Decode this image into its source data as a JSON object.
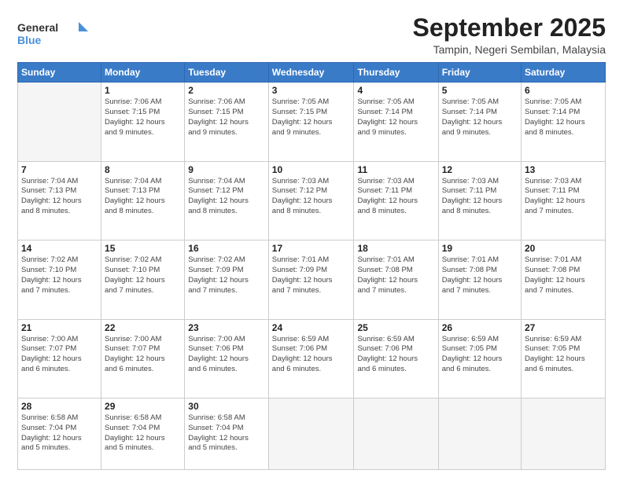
{
  "logo": {
    "line1": "General",
    "line2": "Blue"
  },
  "title": "September 2025",
  "location": "Tampin, Negeri Sembilan, Malaysia",
  "header_days": [
    "Sunday",
    "Monday",
    "Tuesday",
    "Wednesday",
    "Thursday",
    "Friday",
    "Saturday"
  ],
  "weeks": [
    [
      {
        "day": "",
        "info": ""
      },
      {
        "day": "1",
        "info": "Sunrise: 7:06 AM\nSunset: 7:15 PM\nDaylight: 12 hours\nand 9 minutes."
      },
      {
        "day": "2",
        "info": "Sunrise: 7:06 AM\nSunset: 7:15 PM\nDaylight: 12 hours\nand 9 minutes."
      },
      {
        "day": "3",
        "info": "Sunrise: 7:05 AM\nSunset: 7:15 PM\nDaylight: 12 hours\nand 9 minutes."
      },
      {
        "day": "4",
        "info": "Sunrise: 7:05 AM\nSunset: 7:14 PM\nDaylight: 12 hours\nand 9 minutes."
      },
      {
        "day": "5",
        "info": "Sunrise: 7:05 AM\nSunset: 7:14 PM\nDaylight: 12 hours\nand 9 minutes."
      },
      {
        "day": "6",
        "info": "Sunrise: 7:05 AM\nSunset: 7:14 PM\nDaylight: 12 hours\nand 8 minutes."
      }
    ],
    [
      {
        "day": "7",
        "info": "Sunrise: 7:04 AM\nSunset: 7:13 PM\nDaylight: 12 hours\nand 8 minutes."
      },
      {
        "day": "8",
        "info": "Sunrise: 7:04 AM\nSunset: 7:13 PM\nDaylight: 12 hours\nand 8 minutes."
      },
      {
        "day": "9",
        "info": "Sunrise: 7:04 AM\nSunset: 7:12 PM\nDaylight: 12 hours\nand 8 minutes."
      },
      {
        "day": "10",
        "info": "Sunrise: 7:03 AM\nSunset: 7:12 PM\nDaylight: 12 hours\nand 8 minutes."
      },
      {
        "day": "11",
        "info": "Sunrise: 7:03 AM\nSunset: 7:11 PM\nDaylight: 12 hours\nand 8 minutes."
      },
      {
        "day": "12",
        "info": "Sunrise: 7:03 AM\nSunset: 7:11 PM\nDaylight: 12 hours\nand 8 minutes."
      },
      {
        "day": "13",
        "info": "Sunrise: 7:03 AM\nSunset: 7:11 PM\nDaylight: 12 hours\nand 7 minutes."
      }
    ],
    [
      {
        "day": "14",
        "info": "Sunrise: 7:02 AM\nSunset: 7:10 PM\nDaylight: 12 hours\nand 7 minutes."
      },
      {
        "day": "15",
        "info": "Sunrise: 7:02 AM\nSunset: 7:10 PM\nDaylight: 12 hours\nand 7 minutes."
      },
      {
        "day": "16",
        "info": "Sunrise: 7:02 AM\nSunset: 7:09 PM\nDaylight: 12 hours\nand 7 minutes."
      },
      {
        "day": "17",
        "info": "Sunrise: 7:01 AM\nSunset: 7:09 PM\nDaylight: 12 hours\nand 7 minutes."
      },
      {
        "day": "18",
        "info": "Sunrise: 7:01 AM\nSunset: 7:08 PM\nDaylight: 12 hours\nand 7 minutes."
      },
      {
        "day": "19",
        "info": "Sunrise: 7:01 AM\nSunset: 7:08 PM\nDaylight: 12 hours\nand 7 minutes."
      },
      {
        "day": "20",
        "info": "Sunrise: 7:01 AM\nSunset: 7:08 PM\nDaylight: 12 hours\nand 7 minutes."
      }
    ],
    [
      {
        "day": "21",
        "info": "Sunrise: 7:00 AM\nSunset: 7:07 PM\nDaylight: 12 hours\nand 6 minutes."
      },
      {
        "day": "22",
        "info": "Sunrise: 7:00 AM\nSunset: 7:07 PM\nDaylight: 12 hours\nand 6 minutes."
      },
      {
        "day": "23",
        "info": "Sunrise: 7:00 AM\nSunset: 7:06 PM\nDaylight: 12 hours\nand 6 minutes."
      },
      {
        "day": "24",
        "info": "Sunrise: 6:59 AM\nSunset: 7:06 PM\nDaylight: 12 hours\nand 6 minutes."
      },
      {
        "day": "25",
        "info": "Sunrise: 6:59 AM\nSunset: 7:06 PM\nDaylight: 12 hours\nand 6 minutes."
      },
      {
        "day": "26",
        "info": "Sunrise: 6:59 AM\nSunset: 7:05 PM\nDaylight: 12 hours\nand 6 minutes."
      },
      {
        "day": "27",
        "info": "Sunrise: 6:59 AM\nSunset: 7:05 PM\nDaylight: 12 hours\nand 6 minutes."
      }
    ],
    [
      {
        "day": "28",
        "info": "Sunrise: 6:58 AM\nSunset: 7:04 PM\nDaylight: 12 hours\nand 5 minutes."
      },
      {
        "day": "29",
        "info": "Sunrise: 6:58 AM\nSunset: 7:04 PM\nDaylight: 12 hours\nand 5 minutes."
      },
      {
        "day": "30",
        "info": "Sunrise: 6:58 AM\nSunset: 7:04 PM\nDaylight: 12 hours\nand 5 minutes."
      },
      {
        "day": "",
        "info": ""
      },
      {
        "day": "",
        "info": ""
      },
      {
        "day": "",
        "info": ""
      },
      {
        "day": "",
        "info": ""
      }
    ]
  ]
}
